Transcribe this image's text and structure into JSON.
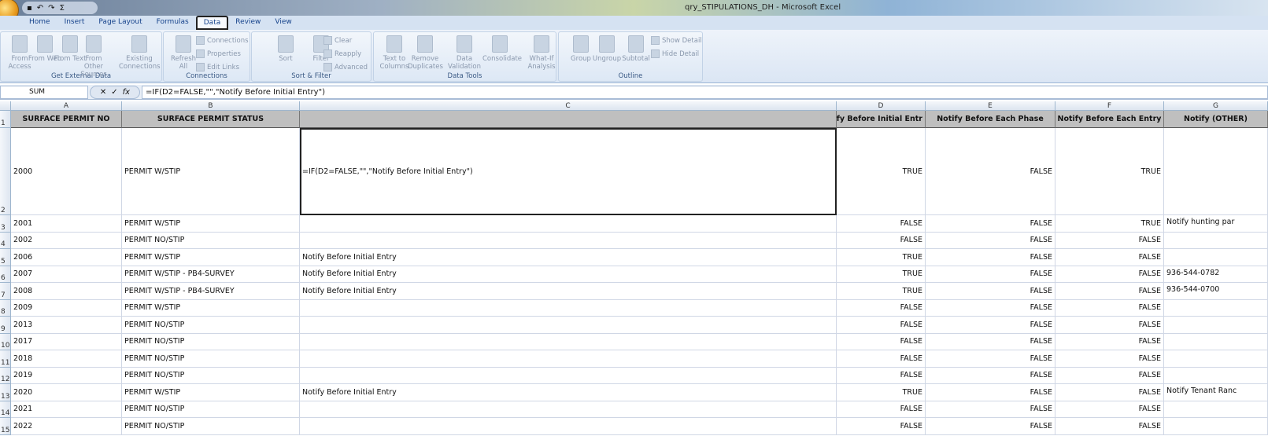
{
  "window": {
    "title": "qry_STIPULATIONS_DH - Microsoft Excel",
    "qat": [
      "save",
      "undo",
      "redo",
      "Σ"
    ]
  },
  "tabs": [
    "Home",
    "Insert",
    "Page Layout",
    "Formulas",
    "Data",
    "Review",
    "View"
  ],
  "active_tab": "Data",
  "ribbon": {
    "groups": [
      {
        "label": "Get External Data",
        "buttons": [
          "From Access",
          "From Web",
          "From Text",
          "From Other Sources",
          "Existing Connections"
        ]
      },
      {
        "label": "Connections",
        "buttons": [
          "Refresh All"
        ],
        "small": [
          "Connections",
          "Properties",
          "Edit Links"
        ]
      },
      {
        "label": "Sort & Filter",
        "buttons": [
          "Sort",
          "Filter"
        ],
        "small": [
          "Clear",
          "Reapply",
          "Advanced"
        ]
      },
      {
        "label": "Data Tools",
        "buttons": [
          "Text to Columns",
          "Remove Duplicates",
          "Data Validation",
          "Consolidate",
          "What-If Analysis"
        ]
      },
      {
        "label": "Outline",
        "buttons": [
          "Group",
          "Ungroup",
          "Subtotal"
        ],
        "small": [
          "Show Detail",
          "Hide Detail"
        ]
      }
    ]
  },
  "formula_bar": {
    "name_box": "SUM",
    "fx": "fx",
    "formula": "=IF(D2=FALSE,\"\",\"Notify Before Initial Entry\")"
  },
  "columns": [
    "A",
    "B",
    "C",
    "D",
    "E",
    "F",
    "G"
  ],
  "headers": [
    "SURFACE PERMIT NO",
    "SURFACE PERMIT STATUS",
    "",
    "Notify Before Initial Entr",
    "Notify Before Each Phase",
    "Notify Before Each Entry",
    "Notify (OTHER)"
  ],
  "rows": [
    {
      "n": "2",
      "c": [
        "2000",
        "PERMIT W/STIP",
        "=IF(D2=FALSE,\"\",\"Notify Before Initial Entry\")",
        "TRUE",
        "FALSE",
        "TRUE",
        ""
      ]
    },
    {
      "n": "3",
      "c": [
        "2001",
        "PERMIT W/STIP",
        "",
        "FALSE",
        "FALSE",
        "TRUE",
        "Notify hunting par"
      ]
    },
    {
      "n": "4",
      "c": [
        "2002",
        "PERMIT NO/STIP",
        "",
        "FALSE",
        "FALSE",
        "FALSE",
        ""
      ]
    },
    {
      "n": "5",
      "c": [
        "2006",
        "PERMIT W/STIP",
        "Notify Before Initial Entry",
        "TRUE",
        "FALSE",
        "FALSE",
        ""
      ]
    },
    {
      "n": "6",
      "c": [
        "2007",
        "PERMIT W/STIP - PB4-SURVEY",
        "Notify Before Initial Entry",
        "TRUE",
        "FALSE",
        "FALSE",
        "936-544-0782"
      ]
    },
    {
      "n": "7",
      "c": [
        "2008",
        "PERMIT W/STIP - PB4-SURVEY",
        "Notify Before Initial Entry",
        "TRUE",
        "FALSE",
        "FALSE",
        "936-544-0700"
      ]
    },
    {
      "n": "8",
      "c": [
        "2009",
        "PERMIT W/STIP",
        "",
        "FALSE",
        "FALSE",
        "FALSE",
        ""
      ]
    },
    {
      "n": "9",
      "c": [
        "2013",
        "PERMIT NO/STIP",
        "",
        "FALSE",
        "FALSE",
        "FALSE",
        ""
      ]
    },
    {
      "n": "10",
      "c": [
        "2017",
        "PERMIT NO/STIP",
        "",
        "FALSE",
        "FALSE",
        "FALSE",
        ""
      ]
    },
    {
      "n": "11",
      "c": [
        "2018",
        "PERMIT NO/STIP",
        "",
        "FALSE",
        "FALSE",
        "FALSE",
        ""
      ]
    },
    {
      "n": "12",
      "c": [
        "2019",
        "PERMIT NO/STIP",
        "",
        "FALSE",
        "FALSE",
        "FALSE",
        ""
      ]
    },
    {
      "n": "13",
      "c": [
        "2020",
        "PERMIT W/STIP",
        "Notify Before Initial Entry",
        "TRUE",
        "FALSE",
        "FALSE",
        "Notify Tenant Ranc"
      ]
    },
    {
      "n": "14",
      "c": [
        "2021",
        "PERMIT NO/STIP",
        "",
        "FALSE",
        "FALSE",
        "FALSE",
        ""
      ]
    },
    {
      "n": "15",
      "c": [
        "2022",
        "PERMIT NO/STIP",
        "",
        "FALSE",
        "FALSE",
        "FALSE",
        ""
      ]
    }
  ]
}
